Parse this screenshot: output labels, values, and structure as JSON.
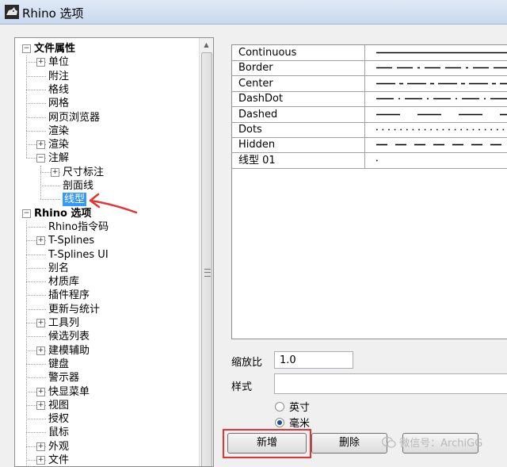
{
  "window": {
    "title": "Rhino 选项"
  },
  "tree": {
    "items": [
      {
        "label": "文件属性",
        "level": 0,
        "expander": "−",
        "bold": true
      },
      {
        "label": "单位",
        "level": 1,
        "expander": "+"
      },
      {
        "label": "附注",
        "level": 1
      },
      {
        "label": "格线",
        "level": 1
      },
      {
        "label": "网格",
        "level": 1
      },
      {
        "label": "网页浏览器",
        "level": 1
      },
      {
        "label": "渲染",
        "level": 1
      },
      {
        "label": "渲染",
        "level": 1,
        "expander": "+"
      },
      {
        "label": "注解",
        "level": 1,
        "expander": "−"
      },
      {
        "label": "尺寸标注",
        "level": 2,
        "expander": "+"
      },
      {
        "label": "剖面线",
        "level": 2
      },
      {
        "label": "线型",
        "level": 2,
        "selected": true
      },
      {
        "label": "Rhino 选项",
        "level": 0,
        "expander": "−",
        "bold": true
      },
      {
        "label": "Rhino指令码",
        "level": 1
      },
      {
        "label": "T-Splines",
        "level": 1,
        "expander": "+"
      },
      {
        "label": "T-Splines UI",
        "level": 1
      },
      {
        "label": "别名",
        "level": 1
      },
      {
        "label": "材质库",
        "level": 1
      },
      {
        "label": "插件程序",
        "level": 1
      },
      {
        "label": "更新与统计",
        "level": 1
      },
      {
        "label": "工具列",
        "level": 1,
        "expander": "+"
      },
      {
        "label": "候选列表",
        "level": 1
      },
      {
        "label": "建模辅助",
        "level": 1,
        "expander": "+"
      },
      {
        "label": "键盘",
        "level": 1
      },
      {
        "label": "警示器",
        "level": 1
      },
      {
        "label": "快显菜单",
        "level": 1,
        "expander": "+"
      },
      {
        "label": "视图",
        "level": 1,
        "expander": "+"
      },
      {
        "label": "授权",
        "level": 1
      },
      {
        "label": "鼠标",
        "level": 1
      },
      {
        "label": "外观",
        "level": 1,
        "expander": "+"
      },
      {
        "label": "文件",
        "level": 1,
        "expander": "+"
      }
    ]
  },
  "linetypes": [
    {
      "name": "Continuous",
      "pattern": "continuous"
    },
    {
      "name": "Border",
      "pattern": "border"
    },
    {
      "name": "Center",
      "pattern": "center"
    },
    {
      "name": "DashDot",
      "pattern": "dashdot"
    },
    {
      "name": "Dashed",
      "pattern": "dashed"
    },
    {
      "name": "Dots",
      "pattern": "dots"
    },
    {
      "name": "Hidden",
      "pattern": "hidden"
    },
    {
      "name": "线型 01",
      "pattern": "dot"
    }
  ],
  "scale": {
    "label": "缩放比",
    "value": "1.0"
  },
  "pattern_field": {
    "label": "样式",
    "value": ""
  },
  "units": {
    "options": [
      "英寸",
      "毫米"
    ],
    "selected": "毫米"
  },
  "buttons": {
    "new": "新增",
    "delete": "删除",
    "third": "重新命名"
  },
  "watermark": "微信号：ArchiGG",
  "colors": {
    "highlight": "#e53434",
    "selection": "#3399ff"
  }
}
